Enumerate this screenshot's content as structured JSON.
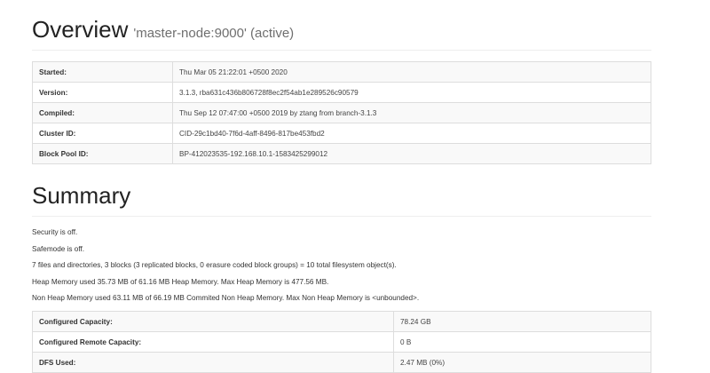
{
  "overview": {
    "title": "Overview",
    "subtitle": "'master-node:9000' (active)",
    "rows": [
      {
        "label": "Started:",
        "value": "Thu Mar 05 21:22:01 +0500 2020"
      },
      {
        "label": "Version:",
        "value": "3.1.3, rba631c436b806728f8ec2f54ab1e289526c90579"
      },
      {
        "label": "Compiled:",
        "value": "Thu Sep 12 07:47:00 +0500 2019 by ztang from branch-3.1.3"
      },
      {
        "label": "Cluster ID:",
        "value": "CID-29c1bd40-7f6d-4aff-8496-817be453fbd2"
      },
      {
        "label": "Block Pool ID:",
        "value": "BP-412023535-192.168.10.1-1583425299012"
      }
    ]
  },
  "summary": {
    "title": "Summary",
    "lines": [
      "Security is off.",
      "Safemode is off.",
      "7 files and directories, 3 blocks (3 replicated blocks, 0 erasure coded block groups) = 10 total filesystem object(s).",
      "Heap Memory used 35.73 MB of 61.16 MB Heap Memory. Max Heap Memory is 477.56 MB.",
      "Non Heap Memory used 63.11 MB of 66.19 MB Commited Non Heap Memory. Max Non Heap Memory is <unbounded>."
    ],
    "rows": [
      {
        "label": "Configured Capacity:",
        "value": "78.24 GB"
      },
      {
        "label": "Configured Remote Capacity:",
        "value": "0 B"
      },
      {
        "label": "DFS Used:",
        "value": "2.47 MB (0%)"
      }
    ]
  }
}
